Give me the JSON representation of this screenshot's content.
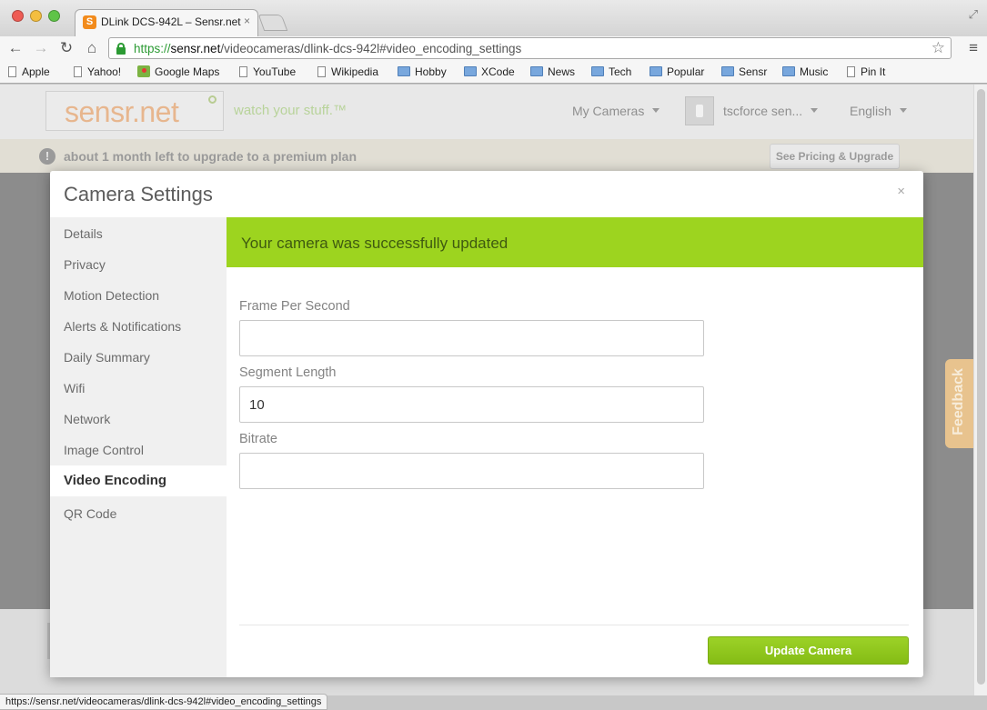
{
  "browser": {
    "tab_title": "DLink DCS-942L – Sensr.net",
    "tab_close": "×",
    "favicon_letter": "S",
    "url_scheme": "https://",
    "url_host": "sensr.net",
    "url_path": "/videocameras/dlink-dcs-942l#video_encoding_settings",
    "bookmarks": [
      "Apple",
      "Yahoo!",
      "Google Maps",
      "YouTube",
      "Wikipedia",
      "Hobby",
      "XCode",
      "News",
      "Tech",
      "Popular",
      "Sensr",
      "Music",
      "Pin It"
    ],
    "status_url": "https://sensr.net/videocameras/dlink-dcs-942l#video_encoding_settings"
  },
  "site": {
    "logo": "sensr.net",
    "tagline": "watch your stuff.™",
    "nav_my_cameras": "My Cameras",
    "nav_user": "tscforce sen...",
    "nav_language": "English",
    "notice_icon": "!",
    "notice": "about 1 month left to upgrade to a premium plan",
    "upgrade_button": "See Pricing & Upgrade",
    "feedback": "Feedback"
  },
  "modal": {
    "title": "Camera Settings",
    "close": "×",
    "sidebar_items": [
      "Details",
      "Privacy",
      "Motion Detection",
      "Alerts & Notifications",
      "Daily Summary",
      "Wifi",
      "Network",
      "Image Control",
      "Video Encoding",
      "QR Code"
    ],
    "active_item": "Video Encoding",
    "success_message": "Your camera was successfully updated",
    "fields": {
      "fps_label": "Frame Per Second",
      "fps_value": "",
      "segment_label": "Segment Length",
      "segment_value": "10",
      "bitrate_label": "Bitrate",
      "bitrate_value": ""
    },
    "update_button": "Update Camera"
  },
  "colors": {
    "success_green": "#9dd41f",
    "button_green": "#8cc41a",
    "accent_orange": "#f28b1c"
  }
}
